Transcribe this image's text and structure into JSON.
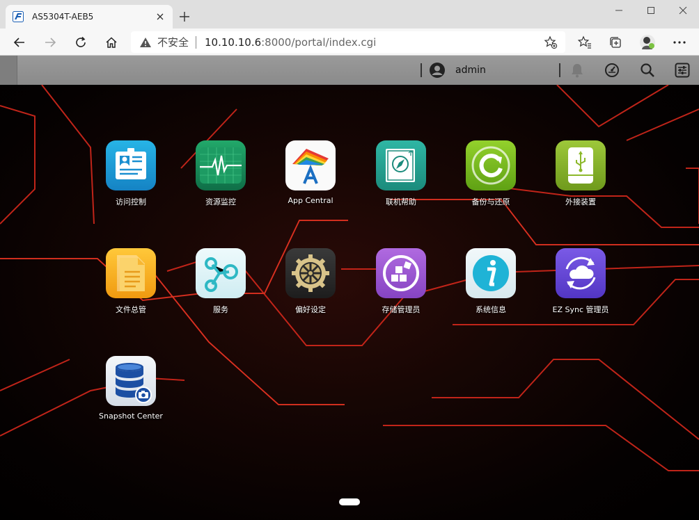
{
  "browser": {
    "tab_title": "AS5304T-AEB5",
    "security_label": "不安全",
    "url_host": "10.10.10.6",
    "url_path": ":8000/portal/index.cgi"
  },
  "header": {
    "username": "admin"
  },
  "apps": [
    {
      "label": "访问控制",
      "icon": "access-control-icon",
      "color": "#1a9fd6"
    },
    {
      "label": "资源监控",
      "icon": "resource-monitor-icon",
      "color": "#1f8f5c"
    },
    {
      "label": "App Central",
      "icon": "app-central-icon",
      "color": "#ffffff"
    },
    {
      "label": "联机帮助",
      "icon": "online-help-icon",
      "color": "#2a9e8d"
    },
    {
      "label": "备份与还原",
      "icon": "backup-restore-icon",
      "color": "#7fbf1f"
    },
    {
      "label": "外接装置",
      "icon": "external-device-icon",
      "color": "#8cb82a"
    },
    {
      "label": "文件总管",
      "icon": "file-explorer-icon",
      "color": "#f5a91c"
    },
    {
      "label": "服务",
      "icon": "services-icon",
      "color": "#dff3f7"
    },
    {
      "label": "偏好设定",
      "icon": "preferences-icon",
      "color": "#2b2b2b"
    },
    {
      "label": "存储管理员",
      "icon": "storage-manager-icon",
      "color": "#9a56d0"
    },
    {
      "label": "系统信息",
      "icon": "system-info-icon",
      "color": "#e9f3f6"
    },
    {
      "label": "EZ Sync 管理员",
      "icon": "ez-sync-icon",
      "color": "#6b4bd8"
    },
    {
      "label": "Snapshot Center",
      "icon": "snapshot-center-icon",
      "color": "#e8eef5"
    }
  ],
  "theme": {
    "accent_red": "#e0241a",
    "header_gray": "#939393"
  }
}
